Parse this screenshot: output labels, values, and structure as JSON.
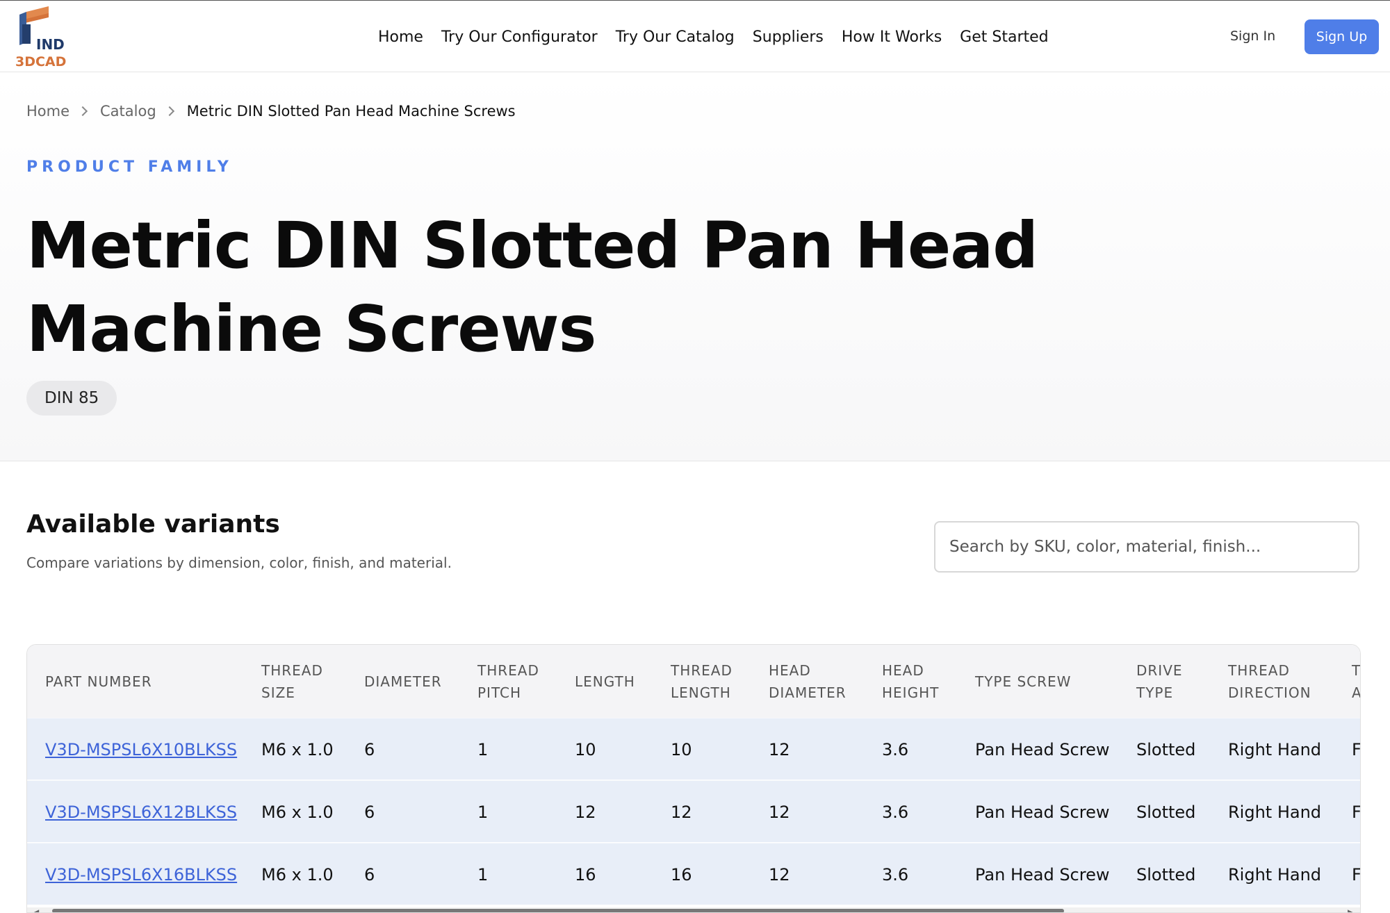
{
  "header": {
    "logo_text_top": "IND",
    "logo_text_bottom": "3DCAD",
    "nav": [
      "Home",
      "Try Our Configurator",
      "Try Our Catalog",
      "Suppliers",
      "How It Works",
      "Get Started"
    ],
    "sign_in": "Sign In",
    "sign_up": "Sign Up",
    "accent_color": "#4f7ee8"
  },
  "breadcrumb": {
    "items": [
      "Home",
      "Catalog"
    ],
    "current": "Metric DIN Slotted Pan Head Machine Screws"
  },
  "hero": {
    "eyebrow": "PRODUCT FAMILY",
    "title": "Metric DIN Slotted Pan Head Machine Screws",
    "badge": "DIN 85"
  },
  "variants": {
    "title": "Available variants",
    "subtitle": "Compare variations by dimension, color, finish, and material.",
    "search_placeholder": "Search by SKU, color, material, finish..."
  },
  "table": {
    "columns": [
      "PART NUMBER",
      "THREAD\nSIZE",
      "DIAMETER",
      "THREAD\nPITCH",
      "LENGTH",
      "THREAD\nLENGTH",
      "HEAD\nDIAMETER",
      "HEAD\nHEIGHT",
      "TYPE SCREW",
      "DRIVE\nTYPE",
      "THREAD\nDIRECTION",
      "T\nA"
    ],
    "rows": [
      [
        "V3D-MSPSL6X10BLKSS",
        "M6 x 1.0",
        "6",
        "1",
        "10",
        "10",
        "12",
        "3.6",
        "Pan Head Screw",
        "Slotted",
        "Right Hand",
        "F"
      ],
      [
        "V3D-MSPSL6X12BLKSS",
        "M6 x 1.0",
        "6",
        "1",
        "12",
        "12",
        "12",
        "3.6",
        "Pan Head Screw",
        "Slotted",
        "Right Hand",
        "F"
      ],
      [
        "V3D-MSPSL6X16BLKSS",
        "M6 x 1.0",
        "6",
        "1",
        "16",
        "16",
        "12",
        "3.6",
        "Pan Head Screw",
        "Slotted",
        "Right Hand",
        "F"
      ]
    ]
  }
}
